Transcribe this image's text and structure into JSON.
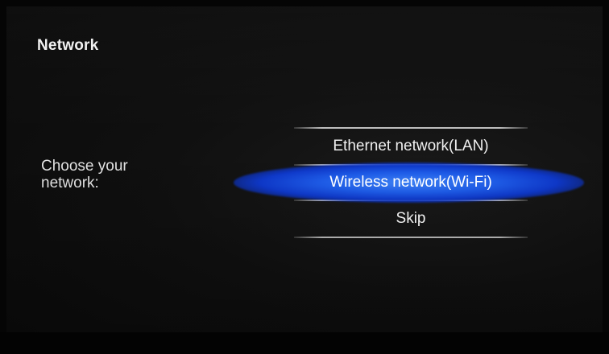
{
  "header": {
    "title": "Network"
  },
  "prompt": {
    "line1": "Choose your",
    "line2": "network:"
  },
  "menu": {
    "items": [
      {
        "label": "Ethernet network(LAN)",
        "selected": false
      },
      {
        "label": "Wireless network(Wi-Fi)",
        "selected": true
      },
      {
        "label": "Skip",
        "selected": false
      }
    ]
  },
  "colors": {
    "background": "#0b0b0b",
    "text": "#f0f0f0",
    "selection_highlight": "#1f5ff0"
  }
}
